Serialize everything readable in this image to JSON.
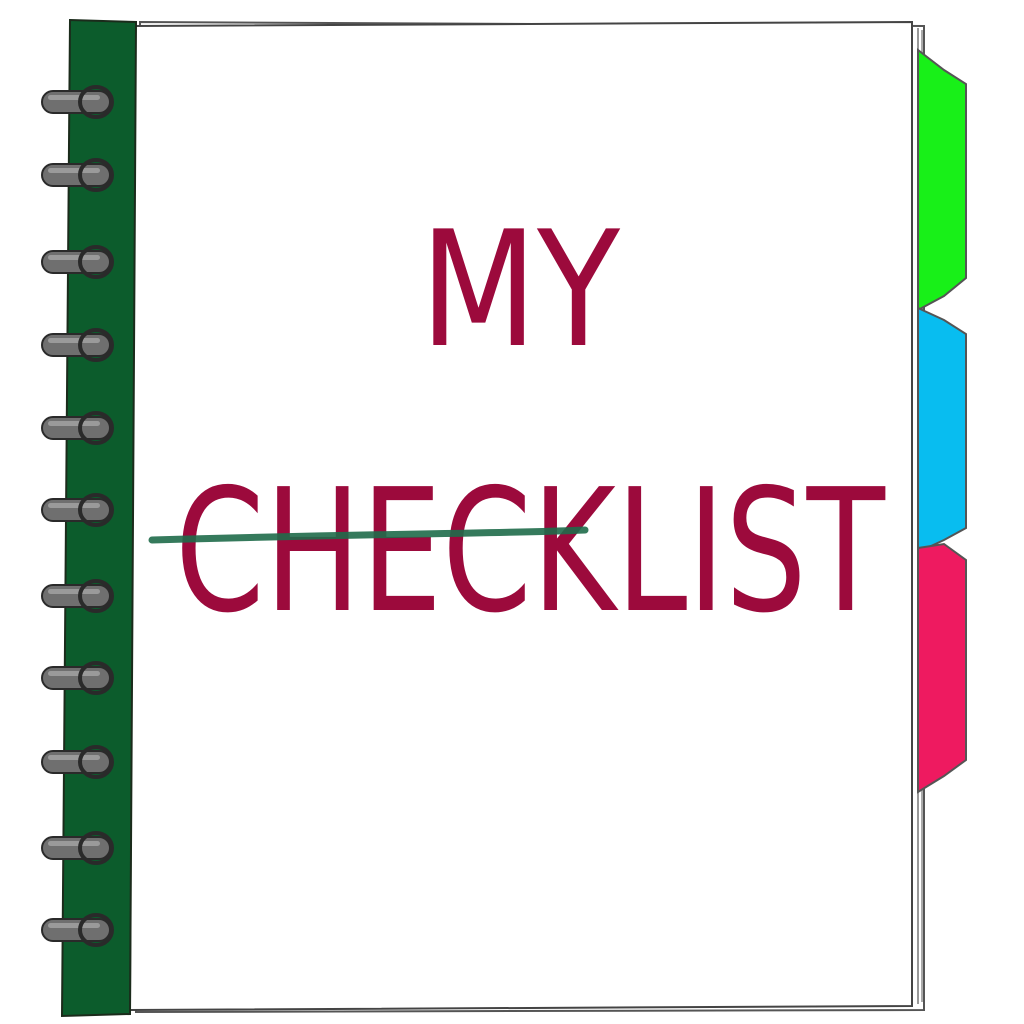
{
  "notebook": {
    "title_line1": "MY",
    "title_line2": "CHECKLIST",
    "strikethrough_part": "CHECK"
  },
  "colors": {
    "spine": "#0c5c2c",
    "page": "#ffffff",
    "title": "#9c0a3c",
    "strike": "#1f6b4a",
    "ring": "#6f6f6f",
    "tab_green": "#18f018",
    "tab_blue": "#08bdf0",
    "tab_pink": "#ee1a60"
  },
  "icons": {
    "rings": "spiral-binding-rings",
    "tabs": "divider-tabs"
  }
}
